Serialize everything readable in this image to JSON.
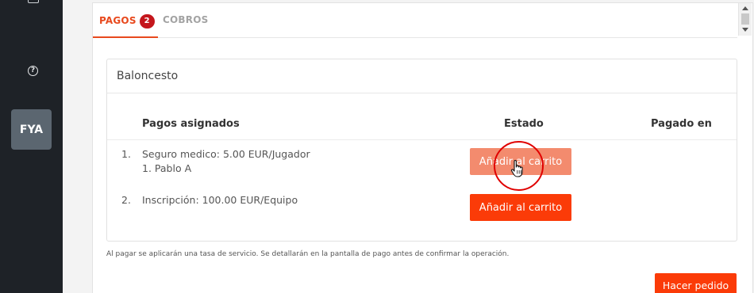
{
  "sidebar": {
    "items": [
      {
        "icon": "grid-icon"
      },
      {
        "icon": "help-icon",
        "glyph": "?"
      }
    ],
    "avatar_initials": "FYA"
  },
  "tabs": [
    {
      "label": "PAGOS",
      "badge": "2",
      "active": true
    },
    {
      "label": "COBROS",
      "active": false
    }
  ],
  "card": {
    "title": "Baloncesto",
    "columns": [
      "Pagos asignados",
      "Estado",
      "Pagado en"
    ],
    "rows": [
      {
        "num": "1.",
        "description": "Seguro medico: 5.00 EUR/Jugador",
        "sub": "1. Pablo A",
        "action": "Añadir al carrito",
        "paid_at": ""
      },
      {
        "num": "2.",
        "description": "Inscripción: 100.00 EUR/Equipo",
        "sub": "",
        "action": "Añadir al carrito",
        "paid_at": ""
      }
    ]
  },
  "note": "Al pagar se aplicarán una tasa de servicio. Se detallarán en la pantalla de pago antes de confirmar la operación.",
  "order_button": "Hacer pedido",
  "colors": {
    "accent": "#e8491d",
    "button": "#fb3b08",
    "button_hover": "#f38b6e",
    "badge": "#c4161c",
    "sidebar": "#1e2227"
  }
}
